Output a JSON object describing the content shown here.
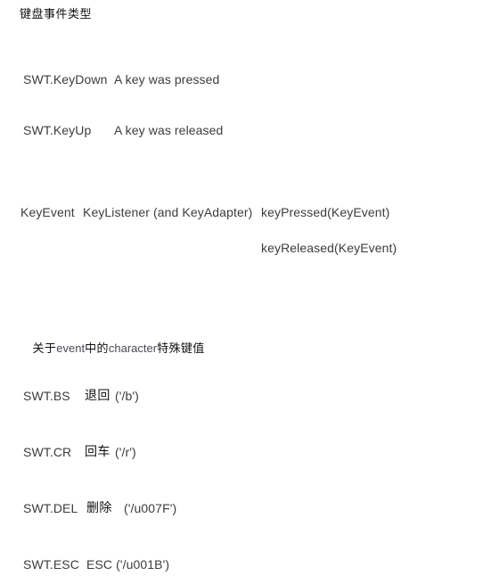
{
  "document": {
    "title": "键盘事件类型",
    "background_color": "#ffffff",
    "text_color": "#3c3c40",
    "cjk_text_color": "#111114"
  },
  "event_types": {
    "heading": "键盘事件类型",
    "rows": [
      {
        "constant": "SWT.KeyDown",
        "description": "A key was pressed"
      },
      {
        "constant": "SWT.KeyUp",
        "description": "A key was released"
      }
    ]
  },
  "listener_table": {
    "event_class": "KeyEvent",
    "listener_interface": "KeyListener (and KeyAdapter)",
    "methods": [
      "keyPressed(KeyEvent)",
      "keyReleased(KeyEvent)"
    ]
  },
  "character_section": {
    "heading_cjk_1": "关于",
    "heading_latin_1": "event",
    "heading_cjk_2": "中的",
    "heading_latin_2": "character",
    "heading_cjk_3": "特殊键值",
    "rows": [
      {
        "constant": "SWT.BS",
        "label": "退回",
        "code": "('/b')"
      },
      {
        "constant": "SWT.CR",
        "label": "回车",
        "code": "('/r')"
      },
      {
        "constant": "SWT.DEL",
        "label": "删除",
        "code": "('/u007F')"
      },
      {
        "constant": "SWT.ESC",
        "label": "ESC",
        "code": "('/u001B')"
      }
    ]
  }
}
